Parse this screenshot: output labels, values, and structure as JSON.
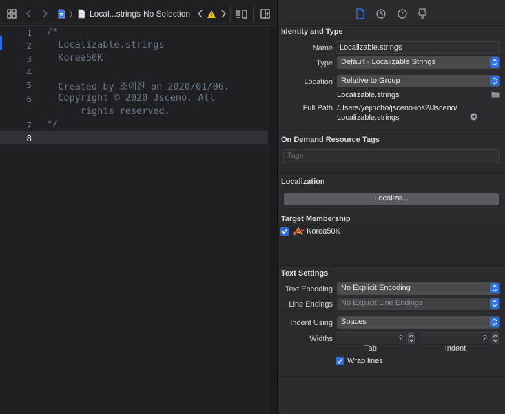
{
  "jumpbar": {
    "file_label": "Local...strings",
    "selection_label": "No Selection"
  },
  "editor": {
    "line_numbers": [
      "1",
      "2",
      "3",
      "4",
      "5",
      "6",
      "7",
      "8"
    ],
    "lines": [
      "/*",
      "  Localizable.strings",
      "  Korea50K",
      "",
      "  Created by 조예진 on 2020/01/06.",
      "  Copyright © 2020 Jsceno. All",
      "      rights reserved.",
      "*/",
      ""
    ]
  },
  "inspector": {
    "identity": {
      "title": "Identity and Type",
      "name_label": "Name",
      "name_value": "Localizable.strings",
      "type_label": "Type",
      "type_value": "Default - Localizable Strings",
      "location_label": "Location",
      "location_value": "Relative to Group",
      "location_file": "Localizable.strings",
      "full_path_label": "Full Path",
      "full_path_line1": "/Users/yejincho/jsceno-ios2/Jsceno/",
      "full_path_line2": "Localizable.strings"
    },
    "on_demand": {
      "title": "On Demand Resource Tags",
      "tags_placeholder": "Tags"
    },
    "localization": {
      "title": "Localization",
      "button_label": "Localize..."
    },
    "target_membership": {
      "title": "Target Membership",
      "target_name": "Korea50K",
      "checked": true
    },
    "text_settings": {
      "title": "Text Settings",
      "encoding_label": "Text Encoding",
      "encoding_value": "No Explicit Encoding",
      "line_endings_label": "Line Endings",
      "line_endings_value": "No Explicit Line Endings",
      "indent_using_label": "Indent Using",
      "indent_using_value": "Spaces",
      "widths_label": "Widths",
      "tab_value": "2",
      "indent_value": "2",
      "tab_label": "Tab",
      "indent_label": "Indent",
      "wrap_lines_label": "Wrap lines",
      "wrap_lines_checked": true
    }
  },
  "colors": {
    "accent": "#2c6fe3",
    "editor_bg": "#1f1f24",
    "inspector_bg": "#2b2b2f",
    "comment_text": "#6c7986",
    "warning": "#f5c518"
  }
}
